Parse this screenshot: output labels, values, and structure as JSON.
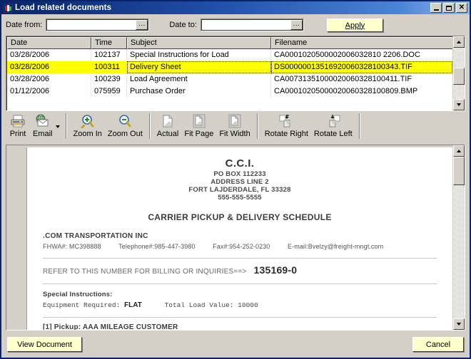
{
  "window": {
    "title": "Load related documents",
    "icon": "app-icon",
    "buttons": {
      "minimize": "minimize",
      "maximize": "maximize",
      "close": "close"
    }
  },
  "filter": {
    "date_from_label": "Date from:",
    "date_from_value": "",
    "date_from_placeholder": "",
    "date_to_label": "Date to:",
    "date_to_value": "",
    "date_to_placeholder": "",
    "browse_label": "...",
    "apply_label": "Apply"
  },
  "list": {
    "columns": [
      "Date",
      "Time",
      "Subject",
      "Filename"
    ],
    "rows": [
      {
        "date": "03/28/2006",
        "time": "102137",
        "subject": "Special Instructions for Load",
        "filename": "CA0001020500002006032810 2206.DOC",
        "selected": false
      },
      {
        "date": "03/28/2006",
        "time": "100311",
        "subject": "Delivery Sheet",
        "filename": "DS00000013516920060328100343.TIF",
        "selected": true
      },
      {
        "date": "03/28/2006",
        "time": "100239",
        "subject": "Load Agreement",
        "filename": "CA00731351000020060328100411.TIF",
        "selected": false
      },
      {
        "date": "01/12/2006",
        "time": "075959",
        "subject": "Purchase Order",
        "filename": "CA00010205000020060328100809.BMP",
        "selected": false
      }
    ],
    "selected_index": 1
  },
  "toolbar": {
    "items": [
      {
        "label": "Print",
        "icon": "printer-icon"
      },
      {
        "label": "Email",
        "icon": "email-icon",
        "has_dropdown": true
      },
      {
        "label": "Zoom In",
        "icon": "zoom-in-icon"
      },
      {
        "label": "Zoom Out",
        "icon": "zoom-out-icon"
      },
      {
        "label": "Actual",
        "icon": "page-actual-icon"
      },
      {
        "label": "Fit Page",
        "icon": "fit-page-icon"
      },
      {
        "label": "Fit Width",
        "icon": "fit-width-icon"
      },
      {
        "label": "Rotate Right",
        "icon": "rotate-right-icon"
      },
      {
        "label": "Rotate Left",
        "icon": "rotate-left-icon"
      }
    ]
  },
  "document": {
    "company_initials": "C.C.I.",
    "address_lines": [
      "PO BOX 112233",
      "ADDRESS LINE 2",
      "FORT LAJDERDALE, FL  33328",
      "555-555-5555"
    ],
    "schedule_title": "CARRIER PICKUP & DELIVERY SCHEDULE",
    "carrier_name": ".COM TRANSPORTATION INC",
    "contact": {
      "fhwa": "FHWA#: MC398888",
      "telephone": "Telephone#:985-447-3980",
      "fax": "Fax#:954-252-0230",
      "email": "E-mail:Bvelzy@freight-mngt.com"
    },
    "reference_text": "REFER TO THIS NUMBER FOR BILLING OR INQUIRIES==>",
    "reference_number": "135169-0",
    "special_instructions_label": "Special Instructions:",
    "equipment_label": "Equipment Required:",
    "equipment_value": "FLAT",
    "total_load_value_label": "Total Load Value:",
    "total_load_value": "10000",
    "pickup_line": "[1] Pickup: AAA MILEAGE CUSTOMER"
  },
  "footer": {
    "view_document_label": "View Document",
    "cancel_label": "Cancel"
  },
  "colors": {
    "titlebar_start": "#0a246a",
    "titlebar_end": "#8fb7e8",
    "face": "#d4d0c8",
    "selection": "#ffff00",
    "button_yellow": "#ffffcc"
  }
}
